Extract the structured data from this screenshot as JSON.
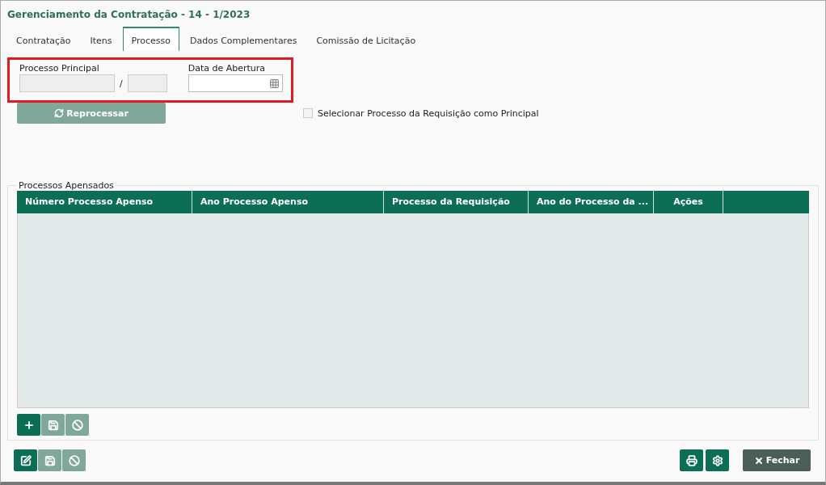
{
  "window": {
    "title": "Gerenciamento da Contratação - 14 - 1/2023"
  },
  "tabs": [
    {
      "label": "Contratação",
      "selected": false
    },
    {
      "label": "Itens",
      "selected": false
    },
    {
      "label": "Processo",
      "selected": true
    },
    {
      "label": "Dados Complementares",
      "selected": false
    },
    {
      "label": "Comissão de Licitação",
      "selected": false
    }
  ],
  "processo_principal": {
    "label": "Processo Principal",
    "separator": "/",
    "disabled": true
  },
  "data_abertura": {
    "label": "Data de Abertura",
    "disabled": false
  },
  "reprocessar_button": {
    "label": "Reprocessar",
    "disabled": true
  },
  "selecionar_checkbox": {
    "label": "Selecionar Processo da Requisição como Principal",
    "checked": false
  },
  "processos_apensados": {
    "legend": "Processos Apensados",
    "columns": [
      "Número Processo Apenso",
      "Ano Processo Apenso",
      "Processo da Requisição",
      "Ano do Processo da ...",
      "Ações"
    ],
    "toolbar": [
      {
        "kind": "add",
        "disabled": false
      },
      {
        "kind": "save",
        "disabled": true
      },
      {
        "kind": "cancel",
        "disabled": true
      }
    ]
  },
  "footer_toolbar": [
    {
      "kind": "edit",
      "disabled": false
    },
    {
      "kind": "save",
      "disabled": true
    },
    {
      "kind": "cancel",
      "disabled": true
    }
  ],
  "footer_right": [
    {
      "kind": "print"
    },
    {
      "kind": "settings"
    }
  ],
  "close_button": {
    "label": "Fechar"
  }
}
